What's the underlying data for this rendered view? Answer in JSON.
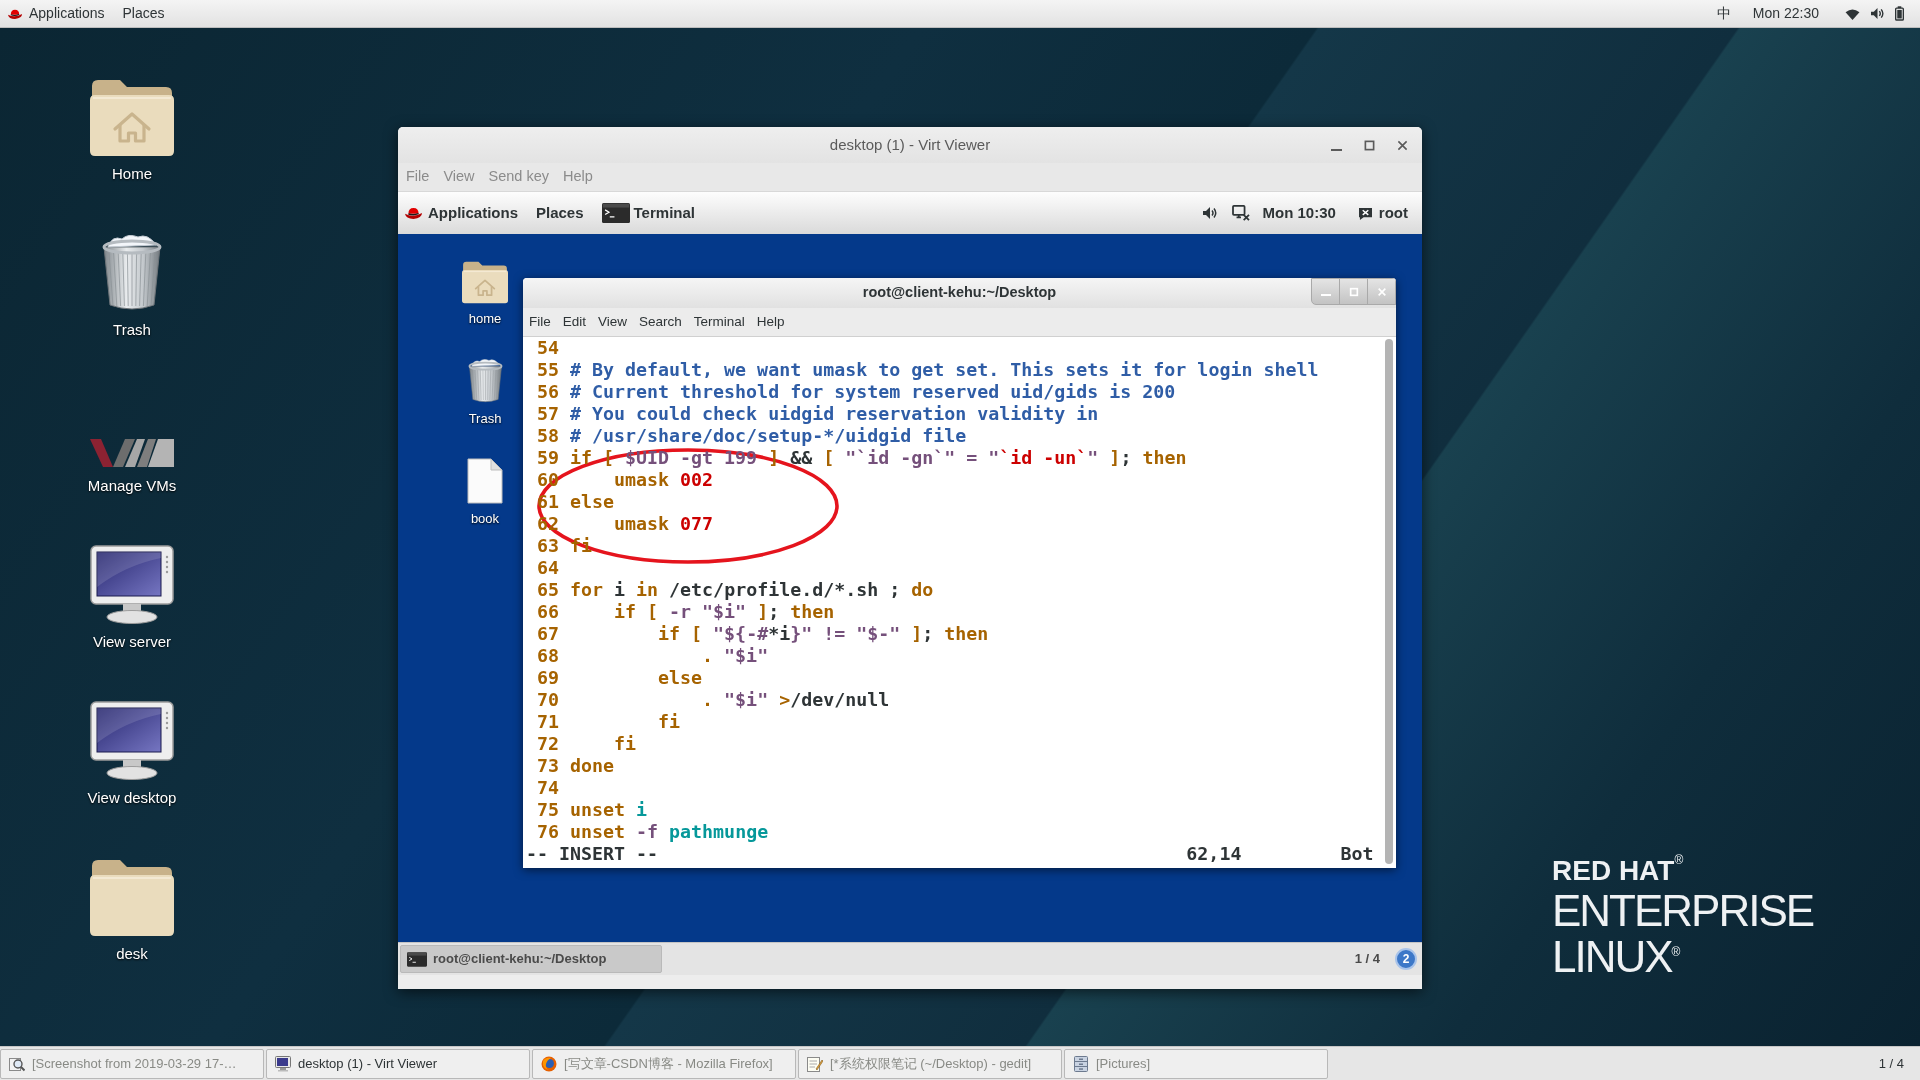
{
  "top_bar": {
    "menus": [
      "Applications",
      "Places"
    ],
    "input_method": "中",
    "clock": "Mon 22:30"
  },
  "desktop_icons": [
    {
      "label": "Home",
      "kind": "home-folder"
    },
    {
      "label": "Trash",
      "kind": "trash"
    },
    {
      "label": "Manage VMs",
      "kind": "vm-logo"
    },
    {
      "label": "View server",
      "kind": "monitor"
    },
    {
      "label": "View desktop",
      "kind": "monitor"
    },
    {
      "label": "desk",
      "kind": "folder"
    }
  ],
  "branding": [
    "RED HAT$^{®}$",
    "ENTERPRISE",
    "LINUX$^{®}$"
  ],
  "viewer_window": {
    "title": "desktop (1) - Virt Viewer",
    "menu": [
      "File",
      "View",
      "Send key",
      "Help"
    ],
    "guest": {
      "top_bar": {
        "menus": [
          "Applications",
          "Places"
        ],
        "task": "Terminal",
        "clock": "Mon 10:30",
        "user": "root"
      },
      "desktop_icons": [
        {
          "label": "home",
          "kind": "home-folder"
        },
        {
          "label": "Trash",
          "kind": "trash"
        },
        {
          "label": "book",
          "kind": "document"
        }
      ],
      "terminal": {
        "title": "root@client-kehu:~/Desktop",
        "menu": [
          "File",
          "Edit",
          "View",
          "Search",
          "Terminal",
          "Help"
        ],
        "lines": [
          {
            "number": "54"
          },
          {
            "number": "55",
            "segments": [
              {
                "kind": "comment",
                "text": "# By default, we want umask to get set. This sets it for login shell"
              }
            ]
          },
          {
            "number": "56",
            "segments": [
              {
                "kind": "comment",
                "text": "# Current threshold for system reserved uid/gids is 200"
              }
            ]
          },
          {
            "number": "57",
            "segments": [
              {
                "kind": "comment",
                "text": "# You could check uidgid reservation validity in"
              }
            ]
          },
          {
            "number": "58",
            "segments": [
              {
                "kind": "comment",
                "text": "# /usr/share/doc/setup-*/uidgid file"
              }
            ]
          },
          {
            "number": "59",
            "segments": [
              {
                "kind": "statement",
                "text": "if [ "
              },
              {
                "kind": "special",
                "text": "$UID -gt 199"
              },
              {
                "kind": "statement",
                "text": " ]"
              },
              {
                "kind": "plain",
                "text": " && "
              },
              {
                "kind": "statement",
                "text": "[ "
              },
              {
                "kind": "special",
                "text": "\"`id -gn`\" = \""
              },
              {
                "kind": "constant",
                "text": "`id -un`"
              },
              {
                "kind": "special",
                "text": "\""
              },
              {
                "kind": "statement",
                "text": " ]"
              },
              {
                "kind": "plain",
                "text": "; "
              },
              {
                "kind": "statement",
                "text": "then"
              }
            ]
          },
          {
            "number": "60",
            "segments": [
              {
                "kind": "statement",
                "text": "    umask "
              },
              {
                "kind": "constant",
                "text": "002"
              }
            ]
          },
          {
            "number": "61",
            "segments": [
              {
                "kind": "statement",
                "text": "else"
              }
            ]
          },
          {
            "number": "62",
            "segments": [
              {
                "kind": "statement",
                "text": "    umask "
              },
              {
                "kind": "constant",
                "text": "077"
              }
            ]
          },
          {
            "number": "63",
            "segments": [
              {
                "kind": "statement",
                "text": "fi"
              }
            ]
          },
          {
            "number": "64"
          },
          {
            "number": "65",
            "segments": [
              {
                "kind": "statement",
                "text": "for"
              },
              {
                "kind": "plain",
                "text": " i "
              },
              {
                "kind": "statement",
                "text": "in"
              },
              {
                "kind": "plain",
                "text": " /etc/profile.d/*.sh ; "
              },
              {
                "kind": "statement",
                "text": "do"
              }
            ]
          },
          {
            "number": "66",
            "segments": [
              {
                "kind": "statement",
                "text": "    if [ "
              },
              {
                "kind": "special",
                "text": "-r \"$i\""
              },
              {
                "kind": "statement",
                "text": " ]"
              },
              {
                "kind": "plain",
                "text": "; "
              },
              {
                "kind": "statement",
                "text": "then"
              }
            ]
          },
          {
            "number": "67",
            "segments": [
              {
                "kind": "statement",
                "text": "        if [ "
              },
              {
                "kind": "special",
                "text": "\"${-#"
              },
              {
                "kind": "plain",
                "text": "*i"
              },
              {
                "kind": "special",
                "text": "}\" != \"$-\""
              },
              {
                "kind": "statement",
                "text": " ]"
              },
              {
                "kind": "plain",
                "text": "; "
              },
              {
                "kind": "statement",
                "text": "then"
              }
            ]
          },
          {
            "number": "68",
            "segments": [
              {
                "kind": "statement",
                "text": "            . "
              },
              {
                "kind": "special",
                "text": "\"$i\""
              }
            ]
          },
          {
            "number": "69",
            "segments": [
              {
                "kind": "statement",
                "text": "        else"
              }
            ]
          },
          {
            "number": "70",
            "segments": [
              {
                "kind": "statement",
                "text": "            . "
              },
              {
                "kind": "special",
                "text": "\"$i\""
              },
              {
                "kind": "statement",
                "text": " >"
              },
              {
                "kind": "plain",
                "text": "/dev/null"
              }
            ]
          },
          {
            "number": "71",
            "segments": [
              {
                "kind": "statement",
                "text": "        fi"
              }
            ]
          },
          {
            "number": "72",
            "segments": [
              {
                "kind": "statement",
                "text": "    fi"
              }
            ]
          },
          {
            "number": "73",
            "segments": [
              {
                "kind": "statement",
                "text": "done"
              }
            ]
          },
          {
            "number": "74"
          },
          {
            "number": "75",
            "segments": [
              {
                "kind": "statement",
                "text": "unset "
              },
              {
                "kind": "identifier",
                "text": "i"
              }
            ]
          },
          {
            "number": "76",
            "segments": [
              {
                "kind": "statement",
                "text": "unset "
              },
              {
                "kind": "special",
                "text": "-f "
              },
              {
                "kind": "identifier",
                "text": "pathmunge"
              }
            ]
          }
        ],
        "status": {
          "mode": "-- INSERT --",
          "ruler": "62,14",
          "position": "Bot"
        },
        "annotations": [
          {
            "kind": "ellipse"
          }
        ]
      },
      "bottom_panel": {
        "tasks": [
          {
            "label": "root@client-kehu:~/Desktop",
            "selected": true
          }
        ],
        "workspace": "1 / 4",
        "notifications": "2"
      }
    }
  },
  "taskbar": {
    "tasks": [
      {
        "label": "[Screenshot from 2019-03-29 17-…",
        "kind": "image-viewer",
        "minimized": true
      },
      {
        "label": "desktop (1) - Virt Viewer",
        "kind": "remote-viewer",
        "minimized": false
      },
      {
        "label": "[写文章-CSDN博客 - Mozilla Firefox]",
        "kind": "browser",
        "minimized": true
      },
      {
        "label": "[*系统权限笔记 (~/Desktop) - gedit]",
        "kind": "text-editor",
        "minimized": true
      },
      {
        "label": "[Pictures]",
        "kind": "file-manager",
        "minimized": true
      }
    ],
    "workspace": "1 / 4"
  }
}
